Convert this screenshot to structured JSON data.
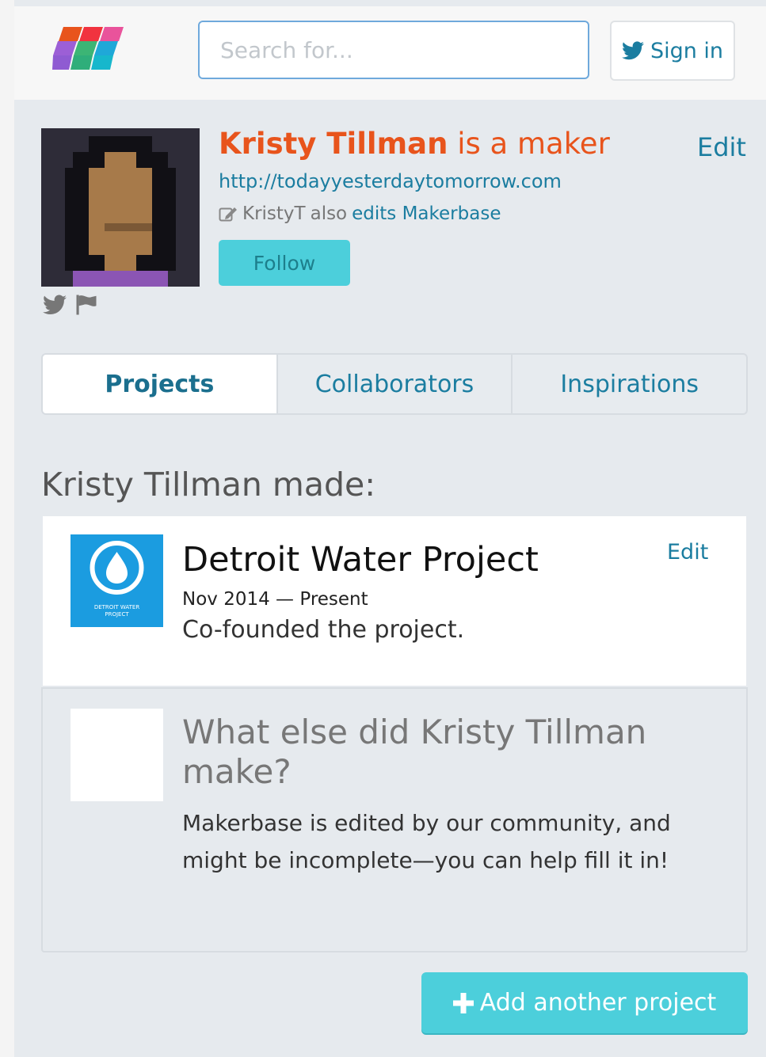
{
  "header": {
    "search_placeholder": "Search for...",
    "signin_label": "Sign in"
  },
  "profile": {
    "name": "Kristy Tillman",
    "name_suffix": " is a maker",
    "edit_label": "Edit",
    "url": "http://todayyesterdaytomorrow.com",
    "editor_handle": "KristyT",
    "editor_also": " also ",
    "editor_link": "edits Makerbase",
    "follow_label": "Follow"
  },
  "tabs": [
    {
      "label": "Projects",
      "active": true
    },
    {
      "label": "Collaborators",
      "active": false
    },
    {
      "label": "Inspirations",
      "active": false
    }
  ],
  "made": {
    "title": "Kristy Tillman made:"
  },
  "project": {
    "title": "Detroit Water Project",
    "edit_label": "Edit",
    "dates": "Nov 2014 — Present",
    "description": "Co-founded the project.",
    "logo_text_line1": "DETROIT WATER",
    "logo_text_line2": "PROJECT"
  },
  "prompt": {
    "title": "What else did Kristy Tillman make?",
    "body": "Makerbase is edited by our community, and might be incomplete—you can help fill it in!"
  },
  "add_button_label": "Add another project",
  "colors": {
    "accent": "#4ccfdb",
    "link": "#1b7da0",
    "maker_name": "#e8541c",
    "background": "#e6eaee"
  }
}
